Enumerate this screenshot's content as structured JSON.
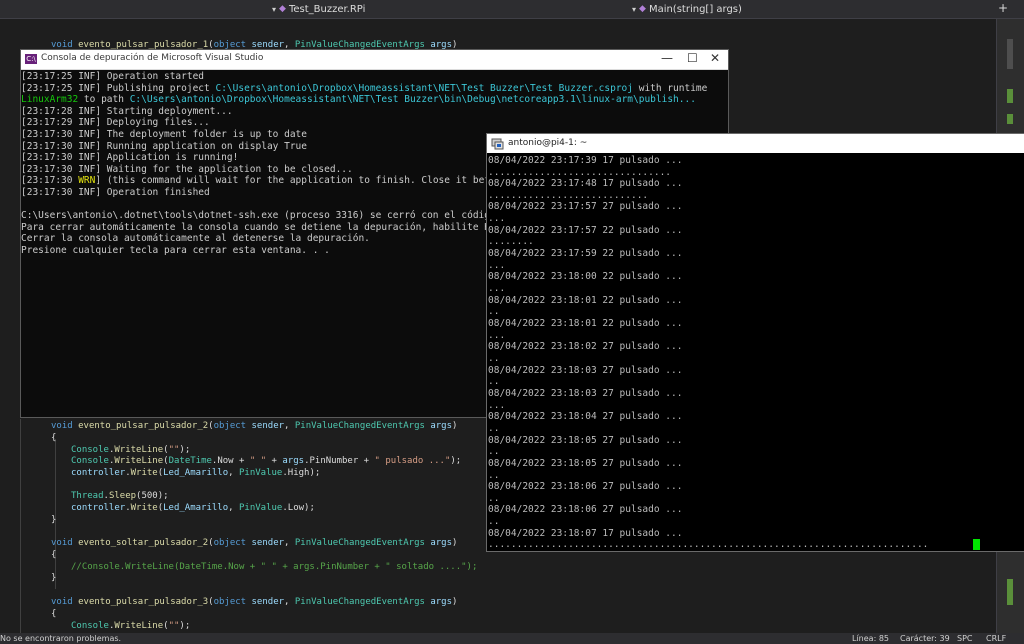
{
  "nav": {
    "project": "Test_Buzzer.RPi",
    "member": "Main(string[] args)",
    "add_label": "+"
  },
  "vs_console": {
    "title": "Consola de depuración de Microsoft Visual Studio",
    "icon_text": "C:\\",
    "minimize": "—",
    "maximize": "☐",
    "close": "✕"
  },
  "putty": {
    "title": "antonio@pi4-1: ~"
  },
  "status": {
    "message": "No se encontraron problemas.",
    "line": "Línea: 85",
    "char": "Carácter: 39",
    "spc": "SPC",
    "crlf": "CRLF"
  },
  "colors": {
    "editor_bg": "#1e1e1e",
    "console_bg": "#0c0c0c",
    "keyword": "#569cd6",
    "type": "#4ec9b0",
    "string": "#d69d85",
    "comment": "#57a64a",
    "cursor": "#00e600"
  }
}
